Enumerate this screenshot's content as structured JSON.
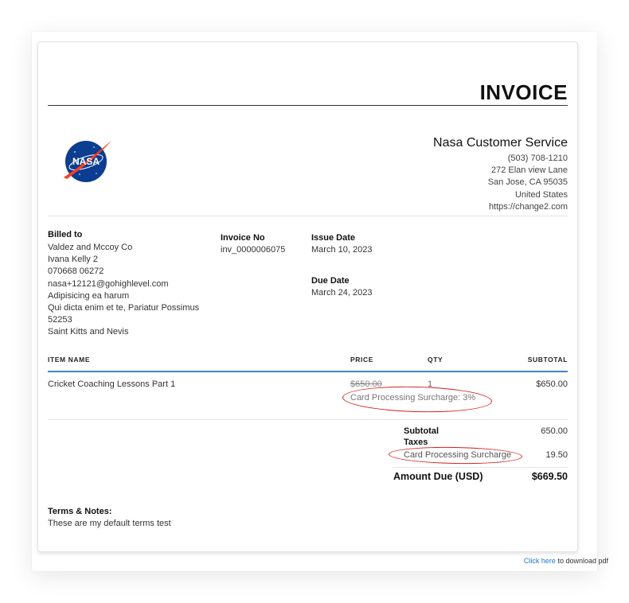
{
  "invoice": {
    "title": "INVOICE",
    "logo_text": "NASA",
    "company": {
      "name": "Nasa Customer Service",
      "phone": "(503) 708-1210",
      "street": "272 Elan view Lane",
      "city": "San Jose, CA 95035",
      "country": "United States",
      "website": "https://change2.com"
    },
    "billed_to": {
      "label": "Billed to",
      "lines": [
        "Valdez and Mccoy Co",
        "Ivana Kelly 2",
        "070668 06272",
        "nasa+12121@gohighlevel.com",
        "Adipisicing ea harum",
        "Qui dicta enim et te, Pariatur Possimus",
        "52253",
        "Saint Kitts and Nevis"
      ]
    },
    "invoice_no": {
      "label": "Invoice No",
      "value": "inv_0000006075"
    },
    "issue_date": {
      "label": "Issue Date",
      "value": "March 10, 2023"
    },
    "due_date": {
      "label": "Due Date",
      "value": "March 24, 2023"
    },
    "table": {
      "headers": {
        "item": "ITEM NAME",
        "price": "PRICE",
        "qty": "QTY",
        "subtotal": "SUBTOTAL"
      },
      "row": {
        "item": "Cricket Coaching Lessons Part 1",
        "price": "$650.00",
        "qty": "1",
        "subtotal": "$650.00",
        "surcharge_note": "Card Processing Surcharge: 3%"
      }
    },
    "totals": {
      "subtotal_label": "Subtotal",
      "subtotal_value": "650.00",
      "taxes_label": "Taxes",
      "surcharge_label": "Card Processing Surcharge",
      "surcharge_value": "19.50",
      "amount_due_label": "Amount Due (USD)",
      "amount_due_value": "$669.50"
    },
    "terms": {
      "label": "Terms & Notes:",
      "text": "These are my default terms test"
    }
  },
  "footer": {
    "link_text": "Click here",
    "suffix": " to download pdf"
  },
  "colors": {
    "accent": "#3a86c8",
    "annotation": "#d41f1f",
    "nasa_blue": "#0b3d91",
    "nasa_red": "#fc3d21"
  }
}
